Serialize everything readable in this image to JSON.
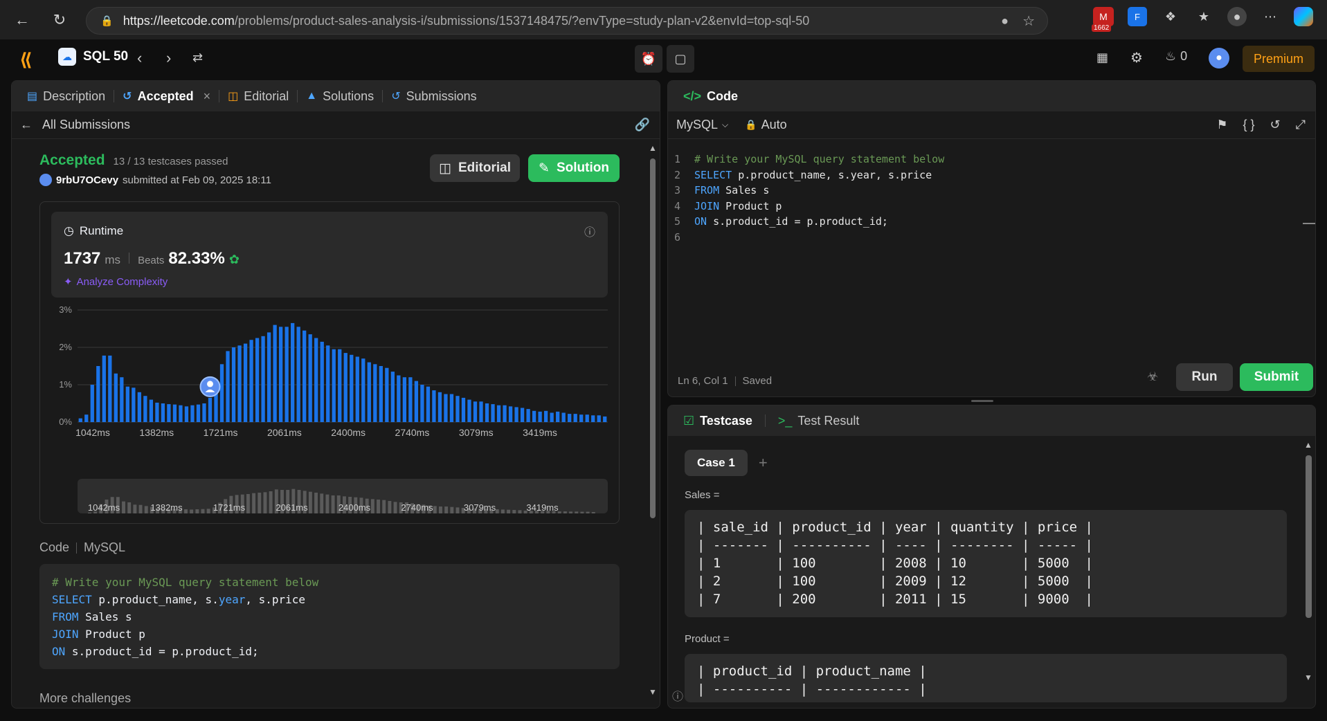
{
  "browser": {
    "url_host": "https://leetcode.com",
    "url_path": "/problems/product-sales-analysis-i/submissions/1537148475/?envType=study-plan-v2&envId=top-sql-50",
    "mail_badge": "1662"
  },
  "topnav": {
    "study_plan": "SQL 50",
    "streak_count": "0",
    "premium_label": "Premium"
  },
  "left_tabs": [
    {
      "label": "Description"
    },
    {
      "label": "Accepted"
    },
    {
      "label": "Editorial"
    },
    {
      "label": "Solutions"
    },
    {
      "label": "Submissions"
    }
  ],
  "submission": {
    "back_label": "All Submissions",
    "status": "Accepted",
    "testcases": "13 / 13 testcases passed",
    "user": "9rbU7OCevy",
    "submitted_text": "submitted at Feb 09, 2025 18:11",
    "editorial_btn": "Editorial",
    "solution_btn": "Solution"
  },
  "runtime": {
    "title": "Runtime",
    "value": "1737",
    "unit": "ms",
    "beats_label": "Beats",
    "beats_value": "82.33%",
    "analyze_label": "Analyze Complexity"
  },
  "chart_data": {
    "type": "bar",
    "ylim": [
      0,
      3
    ],
    "yticks": [
      "3%",
      "2%",
      "1%",
      "0%"
    ],
    "xticks": [
      "1042ms",
      "1382ms",
      "1721ms",
      "2061ms",
      "2400ms",
      "2740ms",
      "3079ms",
      "3419ms"
    ],
    "values": [
      0.1,
      0.2,
      1.0,
      1.5,
      1.78,
      1.78,
      1.3,
      1.2,
      0.95,
      0.92,
      0.8,
      0.7,
      0.6,
      0.52,
      0.5,
      0.48,
      0.47,
      0.45,
      0.42,
      0.45,
      0.47,
      0.5,
      0.65,
      1.15,
      1.55,
      1.9,
      2.0,
      2.05,
      2.1,
      2.2,
      2.25,
      2.3,
      2.4,
      2.6,
      2.55,
      2.55,
      2.65,
      2.55,
      2.45,
      2.35,
      2.25,
      2.15,
      2.05,
      1.95,
      1.95,
      1.85,
      1.8,
      1.75,
      1.7,
      1.6,
      1.55,
      1.5,
      1.45,
      1.35,
      1.25,
      1.2,
      1.2,
      1.1,
      1.0,
      0.95,
      0.85,
      0.8,
      0.75,
      0.75,
      0.7,
      0.65,
      0.6,
      0.55,
      0.55,
      0.5,
      0.48,
      0.45,
      0.45,
      0.42,
      0.4,
      0.38,
      0.35,
      0.3,
      0.28,
      0.3,
      0.25,
      0.28,
      0.25,
      0.22,
      0.22,
      0.2,
      0.2,
      0.18,
      0.18,
      0.15
    ],
    "highlight_index": 22,
    "minimap_labels": [
      "1042ms",
      "1382ms",
      "1721ms",
      "2061ms",
      "2400ms",
      "2740ms",
      "3079ms",
      "3419ms"
    ]
  },
  "code_section": {
    "label": "Code",
    "lang": "MySQL",
    "lines": [
      {
        "parts": [
          {
            "t": "# Write your MySQL query statement below",
            "c": "cm"
          }
        ]
      },
      {
        "parts": [
          {
            "t": "SELECT",
            "c": "kw"
          },
          {
            "t": " p.product_name, s.",
            "c": ""
          },
          {
            "t": "year",
            "c": "kw"
          },
          {
            "t": ", s.price",
            "c": ""
          }
        ]
      },
      {
        "parts": [
          {
            "t": "FROM",
            "c": "kw"
          },
          {
            "t": " Sales s",
            "c": ""
          }
        ]
      },
      {
        "parts": [
          {
            "t": "JOIN",
            "c": "kw"
          },
          {
            "t": " Product p",
            "c": ""
          }
        ]
      },
      {
        "parts": [
          {
            "t": "ON",
            "c": "kw"
          },
          {
            "t": " s.product_id = p.product_id;",
            "c": ""
          }
        ]
      }
    ],
    "more_challenges": "More challenges"
  },
  "editor": {
    "title": "Code",
    "language": "MySQL",
    "auto_label": "Auto",
    "lines": [
      {
        "n": "1",
        "parts": [
          {
            "t": "# Write your MySQL query statement below",
            "c": "cm"
          }
        ]
      },
      {
        "n": "2",
        "parts": [
          {
            "t": "SELECT",
            "c": "kw"
          },
          {
            "t": " p.product_name, s.year, s.price",
            "c": ""
          }
        ]
      },
      {
        "n": "3",
        "parts": [
          {
            "t": "FROM",
            "c": "kw"
          },
          {
            "t": " Sales s",
            "c": ""
          }
        ]
      },
      {
        "n": "4",
        "parts": [
          {
            "t": "JOIN",
            "c": "kw"
          },
          {
            "t": " Product p",
            "c": ""
          }
        ]
      },
      {
        "n": "5",
        "parts": [
          {
            "t": "ON",
            "c": "kw"
          },
          {
            "t": " s.product_id = p.product_id;",
            "c": ""
          }
        ]
      },
      {
        "n": "6",
        "parts": []
      }
    ],
    "cursor_pos": "Ln 6, Col 1",
    "saved_label": "Saved",
    "run_label": "Run",
    "submit_label": "Submit"
  },
  "testcase": {
    "tab_testcase": "Testcase",
    "tab_result": "Test Result",
    "case_label": "Case 1",
    "sales_label": "Sales =",
    "sales_table": "| sale_id | product_id | year | quantity | price |\n| ------- | ---------- | ---- | -------- | ----- |\n| 1       | 100        | 2008 | 10       | 5000  |\n| 2       | 100        | 2009 | 12       | 5000  |\n| 7       | 200        | 2011 | 15       | 9000  |",
    "product_label": "Product =",
    "product_table": "| product_id | product_name |\n| ---------- | ------------ |"
  },
  "colors": {
    "accent_green": "#2cbb5d",
    "bar_blue": "#1a73e8",
    "premium": "#ffa116"
  }
}
